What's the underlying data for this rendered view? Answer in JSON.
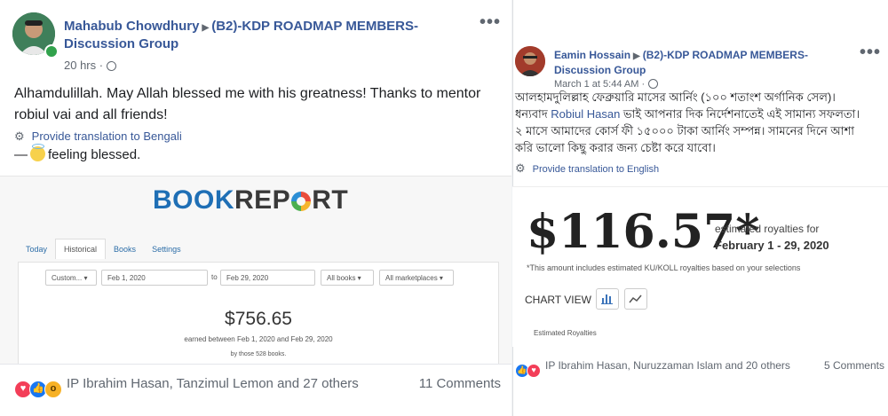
{
  "left_post": {
    "author": "Mahabub Chowdhury",
    "group": "(B2)-KDP ROADMAP MEMBERS-Discussion Group",
    "time": "20 hrs",
    "text": "Alhamdulillah. May Allah blessed me with his greatness! Thanks to mentor robiul vai and all friends!",
    "translate": "Provide translation to Bengali",
    "feeling_prefix": "—",
    "feeling": "feeling blessed.",
    "more": "•••",
    "shared_image": {
      "logo_part1": "BOOK",
      "logo_part2": "REP",
      "logo_part3": "RT",
      "tabs": [
        "Today",
        "Historical",
        "Books",
        "Settings"
      ],
      "active_tab": "Historical",
      "range_select": "Custom... ▾",
      "date_from": "Feb 1, 2020",
      "to_label": "to",
      "date_to": "Feb 29, 2020",
      "books_select": "All books ▾",
      "marketplaces_select": "All marketplaces ▾",
      "amount": "$756.65",
      "earned_text": "earned between Feb 1, 2020 and Feb 29, 2020",
      "books_text": "by those 528 books."
    },
    "reactions": [
      "love",
      "like",
      "wow"
    ],
    "reactors": "IP Ibrahim Hasan, Tanzimul Lemon and 27 others",
    "comments": "11 Comments"
  },
  "right_post": {
    "author": "Eamin Hossain",
    "group": "(B2)-KDP ROADMAP MEMBERS-Discussion Group",
    "time": "March 1 at 5:44 AM",
    "text_part1": "আলহামদুলিল্লাহ ফেব্রুয়ারি মাসের আর্নিং (১০০ শতাংশ অর্গানিক সেল)। ধন্যবাদ ",
    "mention": "Robiul Hasan",
    "text_part2": " ভাই আপনার দিক নির্দেশনাতেই এই সামান্য সফলতা। ২ মাসে আমাদের কোর্স ফী ১৫০০০ টাকা আর্নিং সম্পন্ন। সামনের দিনে আশা করি ভালো কিছু করার জন্য চেষ্টা করে যাবো।",
    "translate": "Provide translation to English",
    "more": "•••",
    "shared_image": {
      "amount": "$116.57*",
      "est_label": "estimated royalties for",
      "est_date": "February 1 - 29, 2020",
      "footnote": "*This amount includes estimated KU/KOLL royalties based on your selections",
      "chart_view": "CHART VIEW",
      "est_royalties": "Estimated Royalties"
    },
    "reactions": [
      "like",
      "love"
    ],
    "reactors": "IP Ibrahim Hasan, Nuruzzaman Islam and 20 others",
    "comments": "5 Comments"
  },
  "colors": {
    "link_blue": "#385898",
    "bookreport_blue": "#1f6fb5",
    "love": "#f33e58",
    "like": "#1877f2",
    "wow": "#f7b125"
  }
}
